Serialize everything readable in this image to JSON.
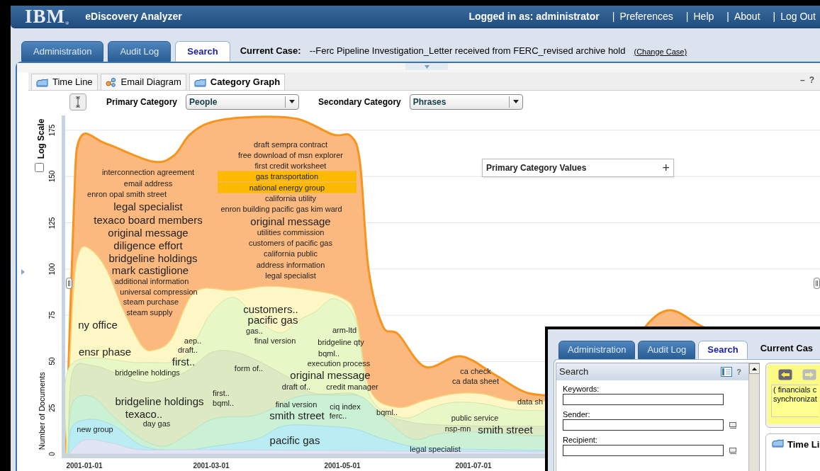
{
  "header": {
    "logo": "IBM",
    "logo_mark": "®",
    "product": "eDiscovery Analyzer",
    "user": "Logged in as: administrator",
    "links": [
      {
        "separator": "|",
        "label": "Preferences"
      },
      {
        "separator": "|",
        "label": "Help"
      },
      {
        "separator": "|",
        "label": "About"
      },
      {
        "separator": "|",
        "label": "Log Out"
      }
    ]
  },
  "tabs": [
    {
      "label": "Administration",
      "selected": false
    },
    {
      "label": "Audit Log",
      "selected": false
    },
    {
      "label": "Search",
      "selected": true
    }
  ],
  "current_case": {
    "label": "Current Case:",
    "value": "--Ferc Pipeline Investigation_Letter received from FERC_revised archive hold",
    "link": "(Change Case)"
  },
  "view_tabs": [
    {
      "label": "Time Line",
      "kind": "chart",
      "selected": false
    },
    {
      "label": "Email Diagram",
      "kind": "diagram",
      "selected": false
    },
    {
      "label": "Category Graph",
      "kind": "chart",
      "selected": true
    }
  ],
  "panel_controls": [
    "–",
    "?"
  ],
  "controls": {
    "primary_label": "Primary Category",
    "primary_value": "People",
    "secondary_label": "Secondary Category",
    "secondary_value": "Phrases"
  },
  "chart": {
    "log_scale": {
      "label": "Log Scale",
      "checked": false
    },
    "y_title": "Number of Documents",
    "y_ticks": [
      "0",
      "25",
      "50",
      "75",
      "100",
      "125",
      "150",
      "175"
    ],
    "x_ticks": [
      "2001-01-01",
      "2001-03-01",
      "2001-05-01",
      "2001-07-01"
    ],
    "legend_box": {
      "title": "Primary Category Values",
      "button": "+"
    },
    "phrases": [
      {
        "text": "interconnection agreement",
        "highlighted": false
      },
      {
        "text": "email address",
        "highlighted": false
      },
      {
        "text": "enron opal  smith street",
        "highlighted": false
      },
      {
        "text": "legal specialist",
        "highlighted": false
      },
      {
        "text": "texaco board members",
        "highlighted": false
      },
      {
        "text": "original message",
        "highlighted": false
      },
      {
        "text": "diligence effort",
        "highlighted": false
      },
      {
        "text": "bridgeline holdings",
        "highlighted": false
      },
      {
        "text": "mark castiglione",
        "highlighted": false
      },
      {
        "text": "additional information",
        "highlighted": false
      },
      {
        "text": "universal compression",
        "highlighted": false
      },
      {
        "text": "steam purchase",
        "highlighted": false
      },
      {
        "text": "steam supply",
        "highlighted": false
      },
      {
        "text": "draft sempra contract",
        "highlighted": false
      },
      {
        "text": "free download of msn explorer",
        "highlighted": false
      },
      {
        "text": "first credit worksheet",
        "highlighted": false
      },
      {
        "text": "gas transportation",
        "highlighted": true
      },
      {
        "text": "national energy group",
        "highlighted": true
      },
      {
        "text": "california utility",
        "highlighted": false
      },
      {
        "text": "enron building  pacific gas kim ward",
        "highlighted": false
      },
      {
        "text": "original message",
        "highlighted": false
      },
      {
        "text": "utilities commission",
        "highlighted": false
      },
      {
        "text": "customers of pacific gas",
        "highlighted": false
      },
      {
        "text": "california public",
        "highlighted": false
      },
      {
        "text": "address information",
        "highlighted": false
      },
      {
        "text": "legal specialist",
        "highlighted": false
      },
      {
        "text": "ny office",
        "highlighted": false
      },
      {
        "text": "ensr phase",
        "highlighted": false
      },
      {
        "text": "customers..",
        "highlighted": false
      },
      {
        "text": "pacific gas",
        "highlighted": false
      },
      {
        "text": "gas..",
        "highlighted": false
      },
      {
        "text": "final version",
        "highlighted": false
      },
      {
        "text": "arm-ltd",
        "highlighted": false
      },
      {
        "text": "bridgeline qty",
        "highlighted": false
      },
      {
        "text": "bqml..",
        "highlighted": false
      },
      {
        "text": "execution process",
        "highlighted": false
      },
      {
        "text": "original message",
        "highlighted": false
      },
      {
        "text": "draft of..",
        "highlighted": false
      },
      {
        "text": "credit manager",
        "highlighted": false
      },
      {
        "text": "aep..",
        "highlighted": false
      },
      {
        "text": "draft..",
        "highlighted": false
      },
      {
        "text": "first..",
        "highlighted": false
      },
      {
        "text": "form of..",
        "highlighted": false
      },
      {
        "text": "bridgeline holdings",
        "highlighted": false
      },
      {
        "text": "bridgeline holdings",
        "highlighted": false
      },
      {
        "text": "texaco..",
        "highlighted": false
      },
      {
        "text": "day gas",
        "highlighted": false
      },
      {
        "text": "first..",
        "highlighted": false
      },
      {
        "text": "bqml..",
        "highlighted": false
      },
      {
        "text": "final version",
        "highlighted": false
      },
      {
        "text": "smith street",
        "highlighted": false
      },
      {
        "text": "ciq index",
        "highlighted": false
      },
      {
        "text": "ferc..",
        "highlighted": false
      },
      {
        "text": "bqml..",
        "highlighted": false
      },
      {
        "text": "new group",
        "highlighted": false
      },
      {
        "text": "pacific gas",
        "highlighted": false
      },
      {
        "text": "ca check",
        "highlighted": false
      },
      {
        "text": "ca data sheet",
        "highlighted": false
      },
      {
        "text": "data sh",
        "highlighted": false
      },
      {
        "text": "public service",
        "highlighted": false
      },
      {
        "text": "nsp-mn",
        "highlighted": false
      },
      {
        "text": "smith street",
        "highlighted": false
      },
      {
        "text": "legal specialist",
        "highlighted": false
      }
    ]
  },
  "overlay": {
    "tabs": [
      {
        "label": "Administration",
        "selected": false
      },
      {
        "label": "Audit Log",
        "selected": false
      },
      {
        "label": "Search",
        "selected": true
      }
    ],
    "current_case_label": "Current Cas",
    "search_panel": {
      "title": "Search",
      "help": "?",
      "fields": [
        {
          "label": "Keywords:",
          "picker": false
        },
        {
          "label": "Sender:",
          "picker": true
        },
        {
          "label": "Recipient:",
          "picker": true
        }
      ]
    },
    "query_lines": [
      "( financials c",
      "synchronizat"
    ],
    "view_tab": "Time Li"
  }
}
